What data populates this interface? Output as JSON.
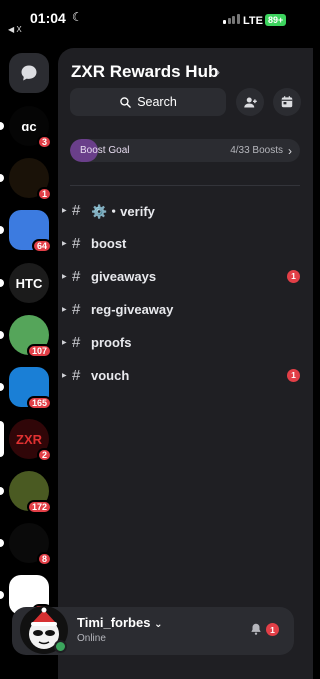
{
  "status_bar": {
    "time": "01:04",
    "back_label": "◀ X",
    "network": "LTE",
    "battery": "89+"
  },
  "rail": {
    "dm_icon": "chat-bubble-icon",
    "servers": [
      {
        "name": "server-ac",
        "text": "ɑc",
        "badge": "3",
        "colors": [
          "#050505",
          "#ffffff"
        ]
      },
      {
        "name": "server-box",
        "text": "",
        "badge": "1",
        "colors": [
          "#1a1208",
          "#c49a3c"
        ]
      },
      {
        "name": "server-goku",
        "text": "",
        "badge": "64",
        "colors": [
          "#3c7be0",
          "#ffffff"
        ]
      },
      {
        "name": "server-htc",
        "text": "HTC",
        "badge": "",
        "colors": [
          "#1b1b1b",
          "#ffffff"
        ]
      },
      {
        "name": "server-green",
        "text": "",
        "badge": "107",
        "colors": [
          "#55a55a",
          "#ffffff"
        ]
      },
      {
        "name": "server-portrait",
        "text": "",
        "badge": "165",
        "colors": [
          "#1a7fd6",
          "#ffffff"
        ]
      },
      {
        "name": "server-zxr",
        "text": "ZXR",
        "badge": "2",
        "colors": [
          "#300608",
          "#e03131"
        ]
      },
      {
        "name": "server-character",
        "text": "",
        "badge": "172",
        "colors": [
          "#4a5a22",
          "#ffffff"
        ]
      },
      {
        "name": "server-star",
        "text": "",
        "badge": "8",
        "colors": [
          "#0a0a0a",
          "#ffffff"
        ]
      },
      {
        "name": "server-ghost",
        "text": "",
        "badge": "58",
        "colors": [
          "#ffffff",
          "#000000"
        ]
      }
    ]
  },
  "guild": {
    "name": "ZXR Rewards Hub",
    "search_label": "Search",
    "boost": {
      "label": "Boost Goal",
      "count": "4/33 Boosts",
      "progress": 0.12
    }
  },
  "channels": [
    {
      "name": "⚙️・verify",
      "badge": ""
    },
    {
      "name": "boost",
      "badge": ""
    },
    {
      "name": "giveaways",
      "badge": "1"
    },
    {
      "name": "reg-giveaway",
      "badge": ""
    },
    {
      "name": "proofs",
      "badge": ""
    },
    {
      "name": "vouch",
      "badge": "1"
    }
  ],
  "user": {
    "name": "Timi_forbes",
    "status": "Online",
    "notifications": "1"
  },
  "colors": {
    "accent_red": "#e23f47",
    "online": "#3ba55d",
    "boost_fill": "#6a3f8a"
  }
}
